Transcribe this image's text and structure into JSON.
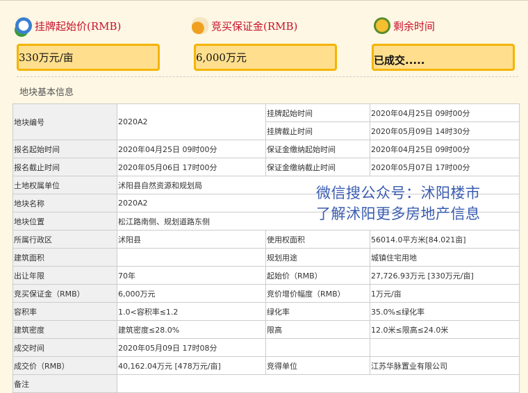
{
  "summary": [
    {
      "icon": "clock-money-icon",
      "title": "挂牌起始价(RMB)",
      "value": "330万元/亩"
    },
    {
      "icon": "money-bag-icon",
      "title": "竞买保证金(RMB)",
      "value": "6,000万元"
    },
    {
      "icon": "alarm-clock-icon",
      "title": "剩余时间",
      "value": "已成交....."
    }
  ],
  "section_title": "地块基本信息",
  "table": {
    "r0": {
      "l": "地块编号",
      "v": "2020A2",
      "l2a": "挂牌起始时间",
      "v2a": "2020年04月25日 09时00分",
      "l2b": "挂牌截止时间",
      "v2b": "2020年05月09日 14时30分"
    },
    "rows": [
      [
        "报名起始时间",
        "2020年04月25日 09时00分",
        "保证金缴纳起始时间",
        "2020年04月25日 09时00分"
      ],
      [
        "报名截止时间",
        "2020年05月06日 17时00分",
        "保证金缴纳截止时间",
        "2020年05月07日 17时00分"
      ],
      [
        "土地权属单位",
        "沭阳县自然资源和规划局"
      ],
      [
        "地块名称",
        "2020A2"
      ],
      [
        "地块位置",
        "松江路南侧、规划道路东侧"
      ],
      [
        "所属行政区",
        "沭阳县",
        "使用权面积",
        "56014.0平方米[84.021亩]"
      ],
      [
        "建筑面积",
        "",
        "规划用途",
        "城镇住宅用地"
      ],
      [
        "出让年限",
        "70年",
        "起始价（RMB）",
        "27,726.93万元 [330万元/亩]"
      ],
      [
        "竞买保证金（RMB）",
        "6,000万元",
        "竞价增价幅度（RMB）",
        "1万元/亩"
      ],
      [
        "容积率",
        "1.0<容积率≤1.2",
        "绿化率",
        "35.0%≤绿化率"
      ],
      [
        "建筑密度",
        "建筑密度≤28.0%",
        "限高",
        "12.0米≤限高≤24.0米"
      ],
      [
        "成交时间",
        "2020年05月09日 17时08分",
        "",
        ""
      ],
      [
        "成交价（RMB）",
        "40,162.04万元 [478万元/亩]",
        "竞得单位",
        "江苏华脉置业有限公司"
      ],
      [
        "备注",
        ""
      ]
    ]
  },
  "watermark": {
    "line1": "微信搜公众号：沭阳楼市",
    "line2": "了解沭阳更多房地产信息"
  }
}
